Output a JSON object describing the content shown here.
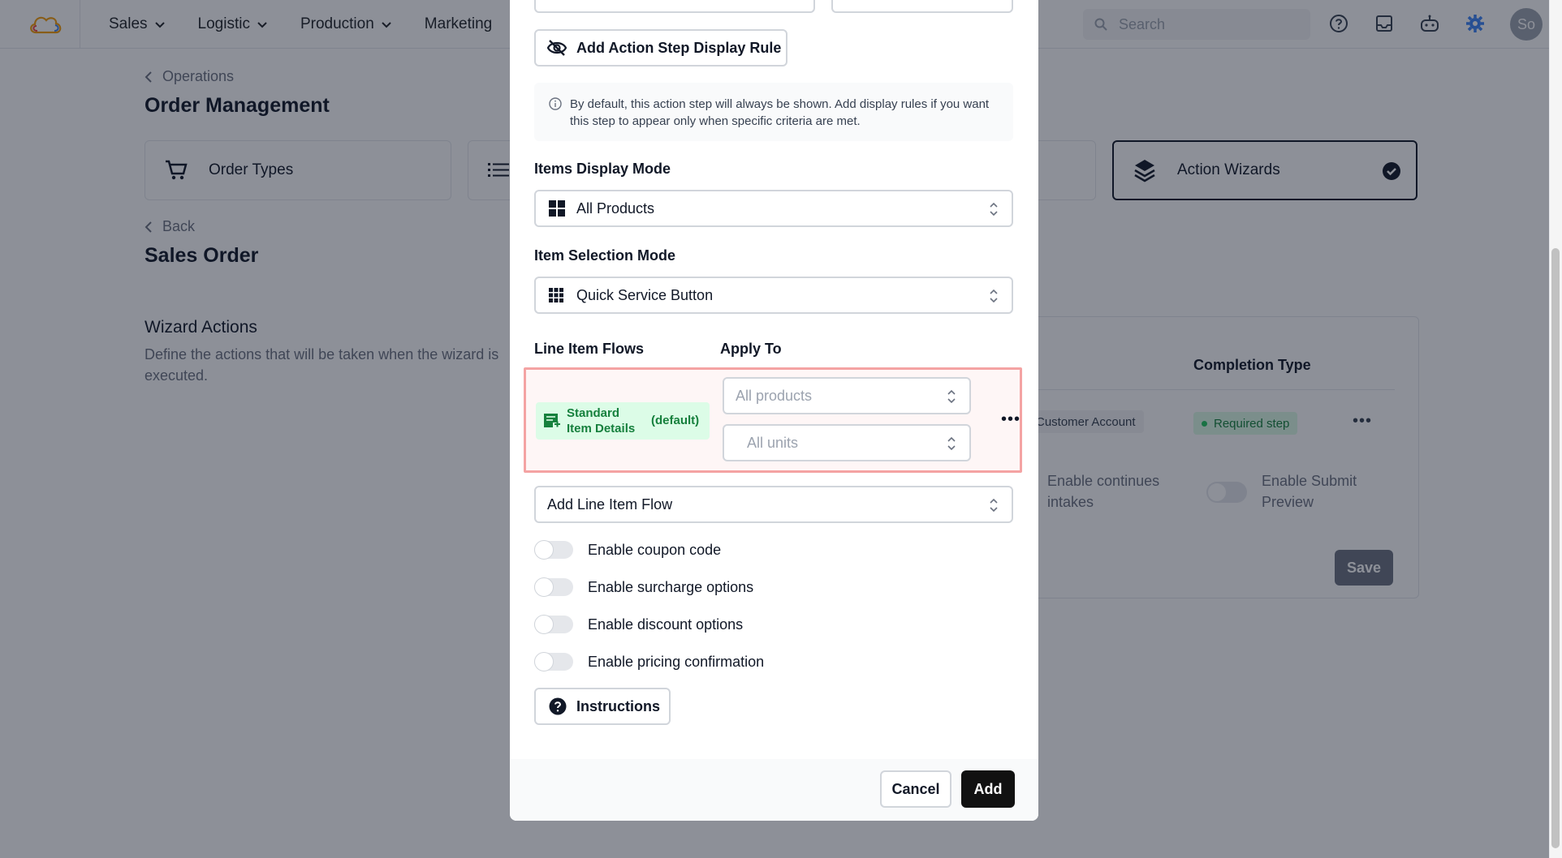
{
  "nav": {
    "items": [
      {
        "label": "Sales"
      },
      {
        "label": "Logistic"
      },
      {
        "label": "Production"
      },
      {
        "label": "Marketing"
      }
    ],
    "search_placeholder": "Search",
    "avatar_initials": "So"
  },
  "page": {
    "breadcrumb_parent": "Operations",
    "title": "Order Management",
    "tabs": [
      {
        "label": "Order Types",
        "icon": "cart-icon"
      },
      {
        "label": "",
        "icon": "list-icon"
      },
      {
        "label": "Action Wizards",
        "icon": "layers-icon",
        "active": true
      }
    ],
    "back_label": "Back",
    "subtitle": "Sales Order",
    "wizard_section_title": "Wizard Actions",
    "wizard_section_desc": "Define the actions that will be taken when the wizard is executed.",
    "table": {
      "completion_type_header": "Completion Type",
      "account_badge": "Customer Account",
      "required_badge": "Required step",
      "toggle_continues_label": "Enable continues intakes",
      "toggle_submit_label": "Enable Submit Preview",
      "save_label": "Save"
    }
  },
  "modal": {
    "display_rule_button": "Add Action Step Display Rule",
    "info_text": "By default, this action step will always be shown. Add display rules if you want this step to appear only when specific criteria are met.",
    "items_display_mode_label": "Items Display Mode",
    "items_display_mode_value": "All Products",
    "item_selection_mode_label": "Item Selection Mode",
    "item_selection_mode_value": "Quick Service Button",
    "line_item_flows_header": "Line Item Flows",
    "apply_to_header": "Apply To",
    "flow": {
      "name": "Standard Item Details",
      "default_tag": "(default)",
      "apply_products_placeholder": "All products",
      "apply_units_placeholder": "All units"
    },
    "add_line_item_flow_placeholder": "Add Line Item Flow",
    "toggles": [
      {
        "label": "Enable coupon code",
        "on": false
      },
      {
        "label": "Enable surcharge options",
        "on": false
      },
      {
        "label": "Enable discount options",
        "on": false
      },
      {
        "label": "Enable pricing confirmation",
        "on": false
      }
    ],
    "instructions_button": "Instructions",
    "cancel_label": "Cancel",
    "add_label": "Add"
  },
  "colors": {
    "accent_dark": "#111111",
    "flow_highlight_border": "#f4a3a3",
    "success_badge_bg": "#dcfce7",
    "success_text": "#16803d",
    "settings_icon": "#3b82f6"
  }
}
